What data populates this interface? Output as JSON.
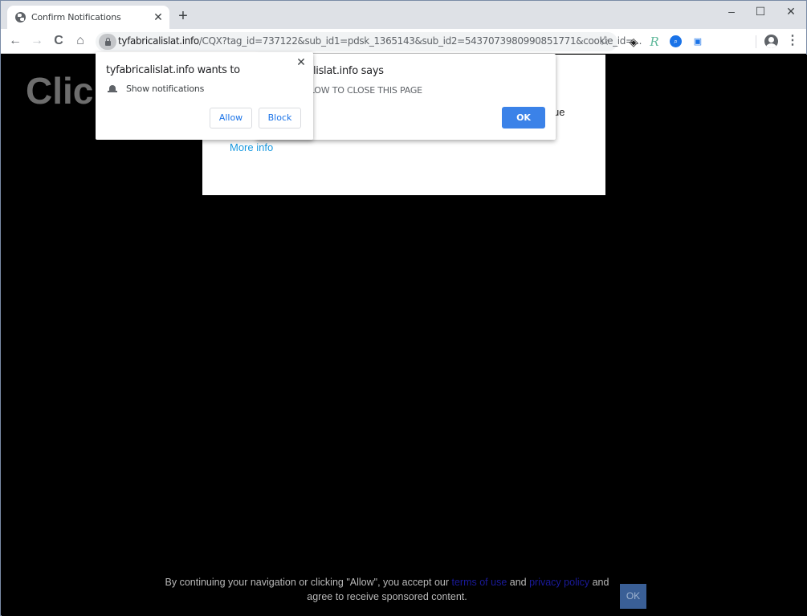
{
  "browser": {
    "tab": {
      "title": "Confirm Notifications",
      "favicon": "globe-icon"
    },
    "new_tab_label": "+",
    "window_controls": {
      "minimize": "–",
      "maximize": "☐",
      "close": "✕"
    },
    "nav": {
      "back": "←",
      "forward": "→",
      "reload": "C",
      "home": "⌂"
    },
    "address_bar": {
      "host": "tyfabricalislat.info",
      "path": "/CQX?tag_id=737122&sub_id1=pdsk_1365143&sub_id2=5437073980990851771&cookie_id=..."
    },
    "bookmark_star": "☆",
    "extensions": [
      {
        "name": "diamond-extension-icon",
        "glyph": "◈"
      },
      {
        "name": "r-extension-icon",
        "glyph": "R"
      },
      {
        "name": "search-extension-icon",
        "glyph": "⌕"
      },
      {
        "name": "screen-extension-icon",
        "glyph": "▣"
      }
    ],
    "menu_glyph": "⋮"
  },
  "page": {
    "headline": "Click Allow if you are not a robot",
    "panel_partial_text": "ue",
    "more_info_label": "More info",
    "footer": {
      "text_before": "By continuing your navigation or clicking \"Allow\", you accept our ",
      "terms_link": "terms of use",
      "text_mid": " and ",
      "privacy_link": "privacy policy",
      "text_after": " and agree to receive sponsored content.",
      "ok_label": "OK"
    }
  },
  "js_dialog": {
    "title": "tyfabricalislat.info says",
    "message": "PRESS ALLOW TO CLOSE THIS PAGE",
    "ok_label": "OK"
  },
  "permission_prompt": {
    "title": "tyfabricalislat.info wants to",
    "permission": "Show notifications",
    "allow_label": "Allow",
    "block_label": "Block",
    "close_glyph": "✕"
  },
  "colors": {
    "accent_blue": "#1a73e8",
    "ok_button": "#3b82e8",
    "headline_gray": "#6d6d6d",
    "more_info": "#1a9ae0"
  }
}
